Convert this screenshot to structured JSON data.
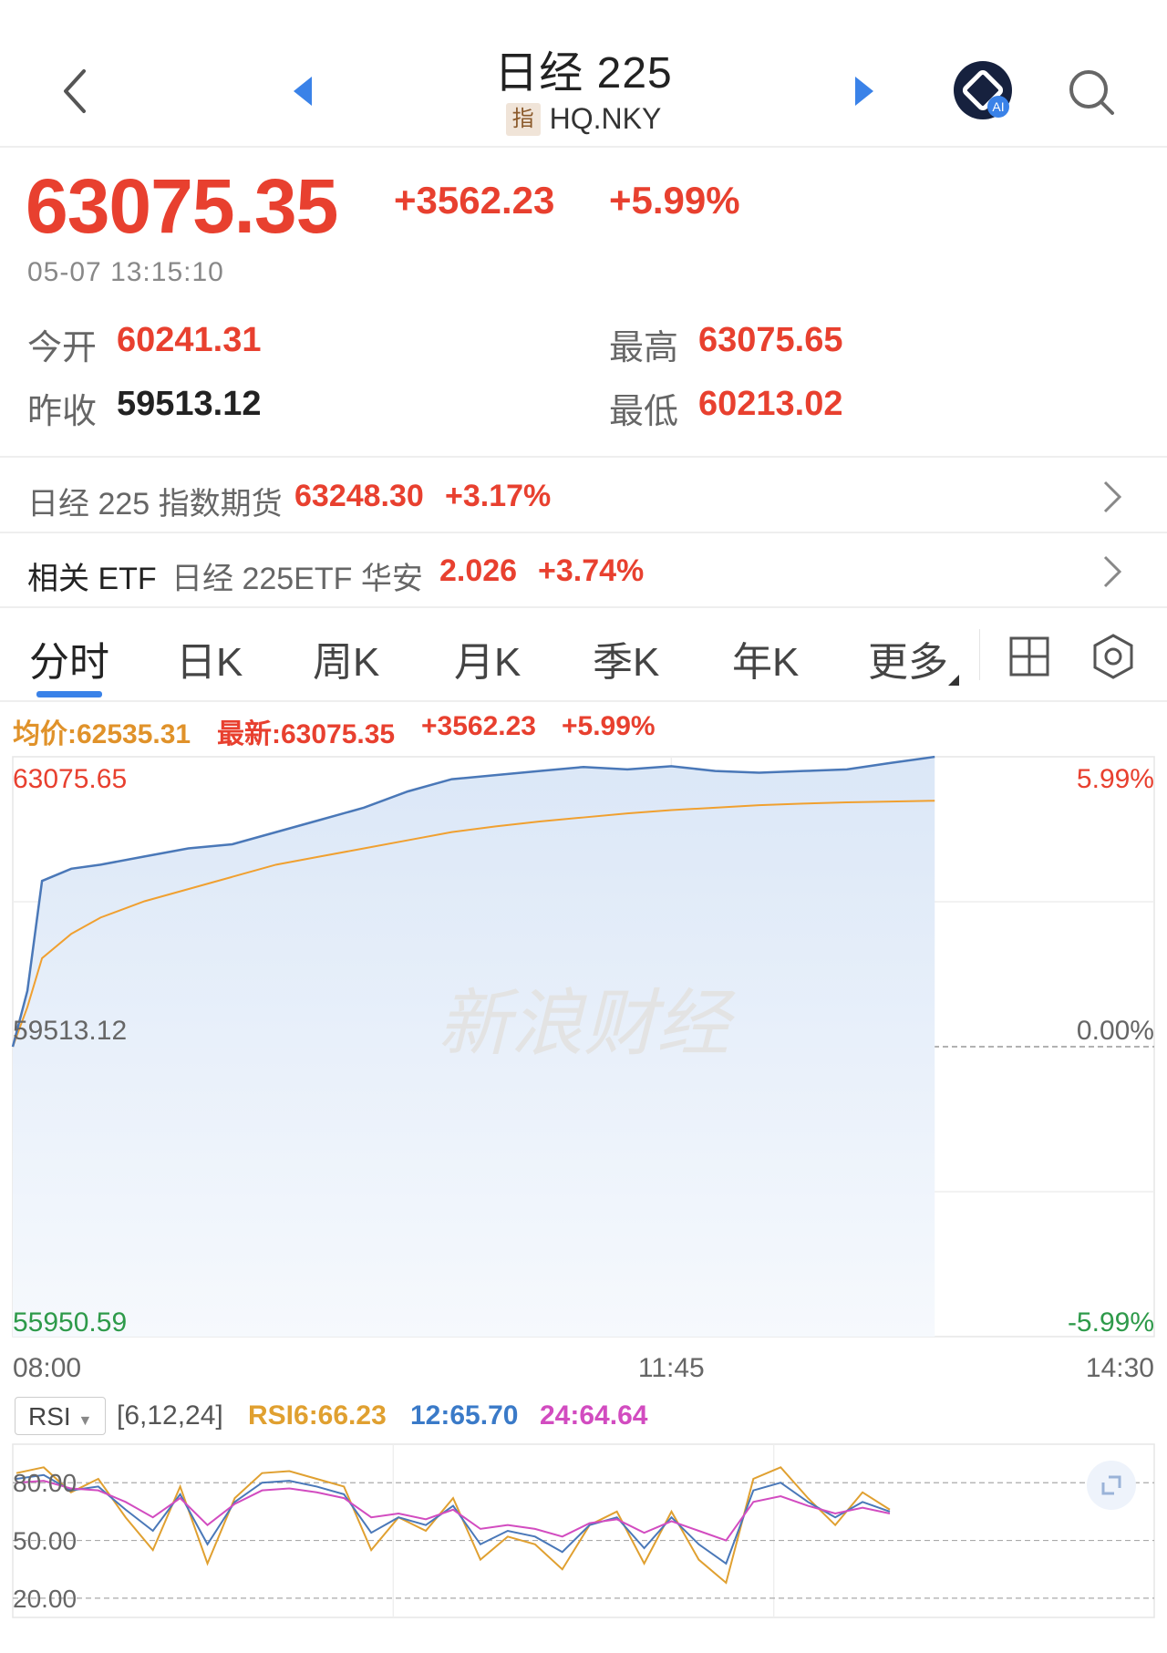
{
  "header": {
    "title": "日经 225",
    "badge": "指",
    "code": "HQ.NKY",
    "ai_label": "AI"
  },
  "quote": {
    "price": "63075.35",
    "change": "+3562.23",
    "change_pct": "+5.99%",
    "timestamp": "05-07 13:15:10",
    "open_label": "今开",
    "open": "60241.31",
    "high_label": "最高",
    "high": "63075.65",
    "prev_close_label": "昨收",
    "prev_close": "59513.12",
    "low_label": "最低",
    "low": "60213.02"
  },
  "futures_row": {
    "label": "日经 225 指数期货",
    "value": "63248.30",
    "change_pct": "+3.17%"
  },
  "etf_row": {
    "label": "相关 ETF",
    "name": "日经 225ETF 华安",
    "value": "2.026",
    "change_pct": "+3.74%"
  },
  "tabs": [
    "分时",
    "日K",
    "周K",
    "月K",
    "季K",
    "年K",
    "更多"
  ],
  "info_line": {
    "avg": "均价:62535.31",
    "latest": "最新:63075.35",
    "change": "+3562.23",
    "change_pct": "+5.99%"
  },
  "watermark": "新浪财经",
  "colors": {
    "up": "#e8402f",
    "down": "#2e9a4a",
    "price_line": "#4a78b8",
    "avg_line": "#f0a030",
    "accent": "#3a82e8"
  },
  "chart_data": [
    {
      "type": "area",
      "x_ticks": [
        "08:00",
        "11:45",
        "14:30"
      ],
      "y_left_labels": [
        "63075.65",
        "59513.12",
        "55950.59"
      ],
      "y_right_labels": [
        "5.99%",
        "0.00%",
        "-5.99%"
      ],
      "ylim": [
        55950.59,
        63075.65
      ],
      "baseline": 59513.12,
      "series": [
        {
          "name": "最新",
          "x": [
            "08:00",
            "08:05",
            "08:10",
            "08:20",
            "08:30",
            "08:45",
            "09:00",
            "09:15",
            "09:30",
            "09:45",
            "10:00",
            "10:15",
            "10:30",
            "10:45",
            "11:00",
            "11:15",
            "11:30",
            "11:45",
            "12:00",
            "12:15",
            "12:30",
            "12:45",
            "13:00",
            "13:15"
          ],
          "values": [
            59513,
            60200,
            61550,
            61700,
            61750,
            61850,
            61950,
            62000,
            62150,
            62300,
            62450,
            62650,
            62800,
            62850,
            62900,
            62950,
            62920,
            62960,
            62900,
            62880,
            62900,
            62920,
            63000,
            63075
          ]
        },
        {
          "name": "均价",
          "x": [
            "08:00",
            "08:05",
            "08:10",
            "08:20",
            "08:30",
            "08:45",
            "09:00",
            "09:15",
            "09:30",
            "09:45",
            "10:00",
            "10:15",
            "10:30",
            "10:45",
            "11:00",
            "11:15",
            "11:30",
            "11:45",
            "12:00",
            "12:15",
            "12:30",
            "12:45",
            "13:00",
            "13:15"
          ],
          "values": [
            59513,
            60000,
            60600,
            60900,
            61100,
            61300,
            61450,
            61600,
            61750,
            61850,
            61950,
            62050,
            62150,
            62220,
            62280,
            62330,
            62380,
            62420,
            62450,
            62480,
            62500,
            62515,
            62525,
            62535
          ]
        }
      ]
    },
    {
      "type": "line",
      "indicator": "RSI",
      "params": "[6,12,24]",
      "y_ticks": [
        "80.00",
        "50.00",
        "20.00"
      ],
      "ylim": [
        10,
        100
      ],
      "legend": [
        "RSI6:66.23",
        "12:65.70",
        "24:64.64"
      ],
      "series": [
        {
          "name": "RSI6",
          "values": [
            85,
            88,
            75,
            82,
            62,
            45,
            78,
            38,
            72,
            85,
            86,
            82,
            78,
            45,
            62,
            55,
            72,
            40,
            52,
            48,
            35,
            58,
            65,
            38,
            65,
            40,
            28,
            82,
            88,
            72,
            58,
            75,
            66
          ]
        },
        {
          "name": "12",
          "values": [
            82,
            84,
            76,
            78,
            66,
            55,
            74,
            48,
            70,
            80,
            81,
            78,
            74,
            54,
            62,
            58,
            68,
            48,
            55,
            52,
            44,
            58,
            62,
            46,
            62,
            48,
            38,
            76,
            80,
            70,
            62,
            70,
            65
          ]
        },
        {
          "name": "24",
          "values": [
            80,
            81,
            77,
            76,
            70,
            62,
            72,
            58,
            69,
            76,
            77,
            75,
            72,
            62,
            64,
            61,
            66,
            56,
            58,
            56,
            52,
            59,
            61,
            54,
            60,
            55,
            50,
            70,
            73,
            68,
            64,
            67,
            64
          ]
        }
      ]
    }
  ]
}
